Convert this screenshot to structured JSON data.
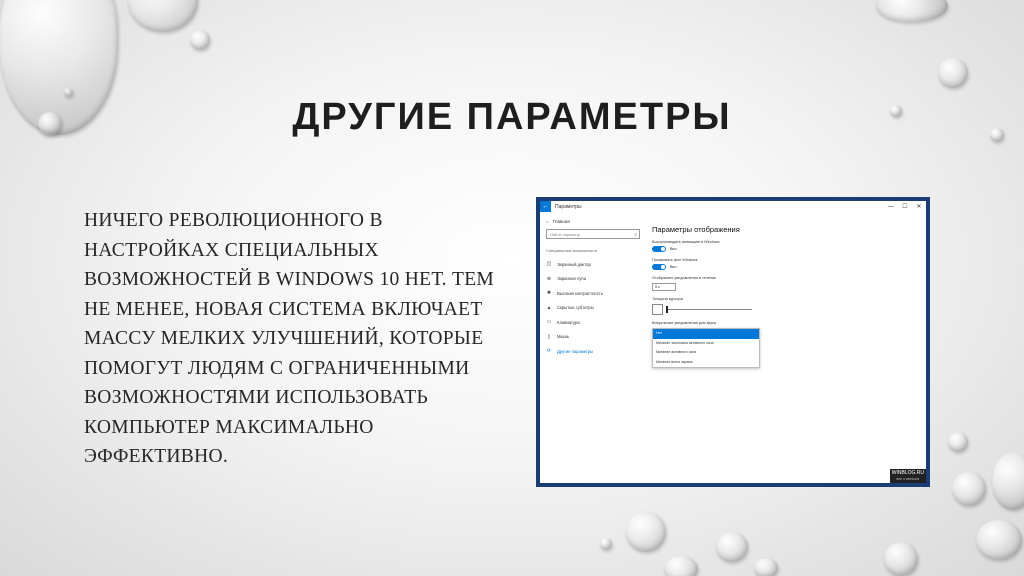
{
  "slide": {
    "title": "ДРУГИЕ ПАРАМЕТРЫ",
    "body": "Ничего революционного в настройках специальных возможностей в Windows 10 нет. Тем не менее, новая система включает массу мелких улучшений, которые помогут людям с ограниченными возможностями использовать компьютер максимально эффективно."
  },
  "screenshot": {
    "window_title": "Параметры",
    "back_icon": "back-arrow-icon",
    "controls": {
      "minimize": "—",
      "maximize": "☐",
      "close": "✕"
    },
    "sidebar": {
      "home_label": "Главная",
      "search_placeholder": "Найти параметр",
      "category": "Специальные возможности",
      "items": [
        {
          "label": "Экранный диктор",
          "icon": "narrator-icon"
        },
        {
          "label": "Экранная лупа",
          "icon": "magnifier-icon"
        },
        {
          "label": "Высокая контрастность",
          "icon": "contrast-icon"
        },
        {
          "label": "Скрытые субтитры",
          "icon": "captions-icon"
        },
        {
          "label": "Клавиатура",
          "icon": "keyboard-icon"
        },
        {
          "label": "Мышь",
          "icon": "mouse-icon"
        },
        {
          "label": "Другие параметры",
          "icon": "other-options-icon"
        }
      ]
    },
    "main": {
      "title": "Параметры отображения",
      "animation_label": "Воспроизводить анимацию в Windows",
      "animation_state": "Вкл.",
      "background_label": "Показывать фон Windows",
      "background_state": "Вкл.",
      "notify_label": "Отображать уведомления в течение",
      "notify_value": "5 с",
      "cursor_label": "Толщина курсора",
      "cursor_value": 0,
      "visual_label": "Визуальные уведомления для звука",
      "visual_options": [
        "Нет",
        "Мигание заголовка активного окна",
        "Мигание активного окна",
        "Мигание всего экрана"
      ]
    },
    "watermark": "WINBLOG.RU",
    "watermark_sub": "всё о windows"
  }
}
